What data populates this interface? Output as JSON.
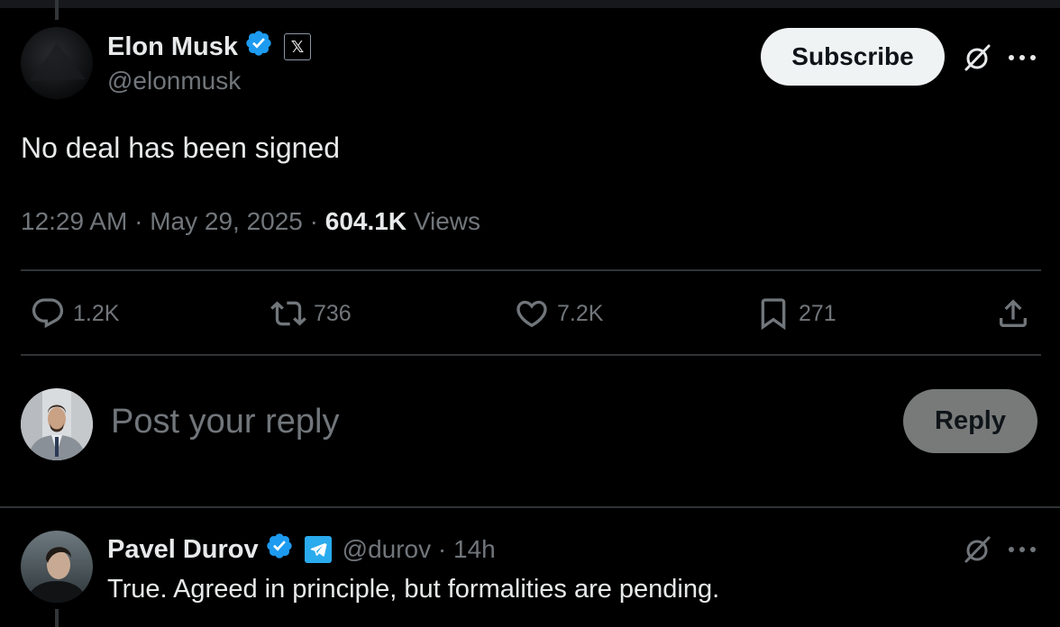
{
  "tweet": {
    "author": {
      "name": "Elon Musk",
      "handle": "@elonmusk",
      "verified_icon": "verified-badge-icon",
      "affiliation_icon": "x-logo-icon",
      "affiliation_glyph": "𝕏"
    },
    "subscribe_label": "Subscribe",
    "text": "No deal has been signed",
    "time": "12:29 AM",
    "separator1": " · ",
    "date": "May 29, 2025",
    "separator2": " · ",
    "views_count": "604.1K",
    "views_label": " Views",
    "actions": {
      "replies": "1.2K",
      "reposts": "736",
      "likes": "7.2K",
      "bookmarks": "271"
    }
  },
  "reply_box": {
    "placeholder": "Post your reply",
    "button_label": "Reply"
  },
  "reply": {
    "author_name": "Pavel Durov",
    "handle": "@durov",
    "separator": " · ",
    "time": "14h",
    "text": "True. Agreed in principle, but formalities are pending.",
    "affiliation_icon": "telegram-logo-icon"
  },
  "colors": {
    "background": "#000000",
    "text_primary": "#e7e9ea",
    "text_secondary": "#71767b",
    "verified_blue": "#1d9bf0",
    "divider": "#2f3336",
    "telegram_blue": "#2aabee"
  }
}
